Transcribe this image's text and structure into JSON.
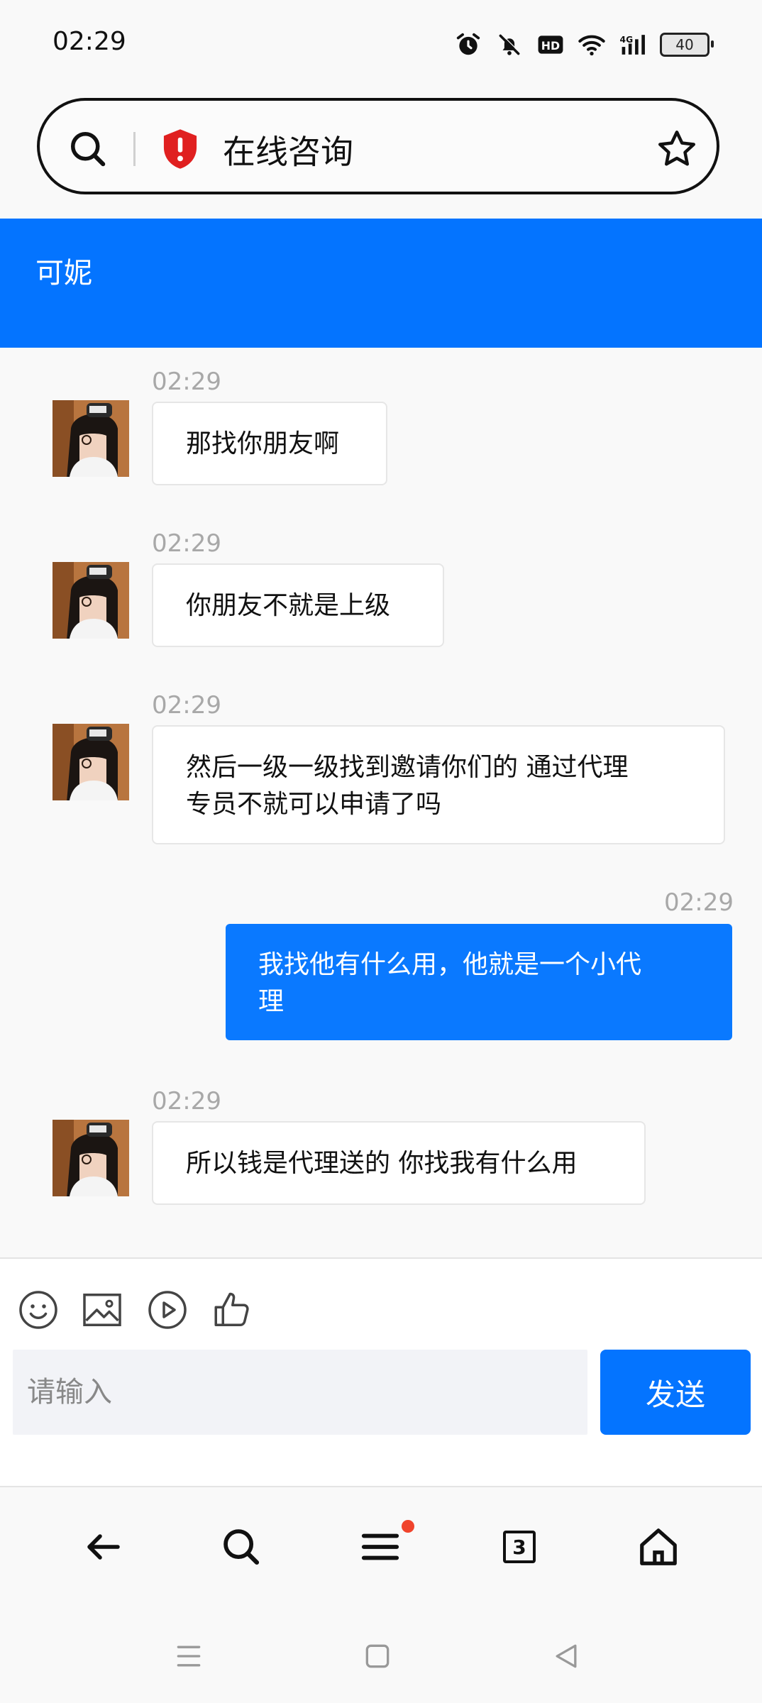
{
  "status_bar": {
    "time": "02:29",
    "battery": "40"
  },
  "browser": {
    "url_title": "在线咨询",
    "tabs_count": "3"
  },
  "chat": {
    "title": "可妮"
  },
  "messages": [
    {
      "time": "02:29",
      "direction": "incoming",
      "lines": [
        "那找你朋友啊"
      ]
    },
    {
      "time": "02:29",
      "direction": "incoming",
      "lines": [
        "你朋友不就是上级"
      ]
    },
    {
      "time": "02:29",
      "direction": "incoming",
      "lines": [
        "然后一级一级找到邀请你们的 通过代理",
        "专员不就可以申请了吗"
      ]
    },
    {
      "time": "02:29",
      "direction": "outgoing",
      "lines": [
        "我找他有什么用，他就是一个小代",
        "理"
      ]
    },
    {
      "time": "02:29",
      "direction": "incoming",
      "lines": [
        "所以钱是代理送的 你找我有什么用"
      ]
    }
  ],
  "composer": {
    "placeholder": "请输入",
    "send_label": "发送"
  },
  "colors": {
    "accent": "#0474ff",
    "outgoing_bubble": "#0a79ff",
    "notification_dot": "#f0442c",
    "shield": "#e02020"
  }
}
